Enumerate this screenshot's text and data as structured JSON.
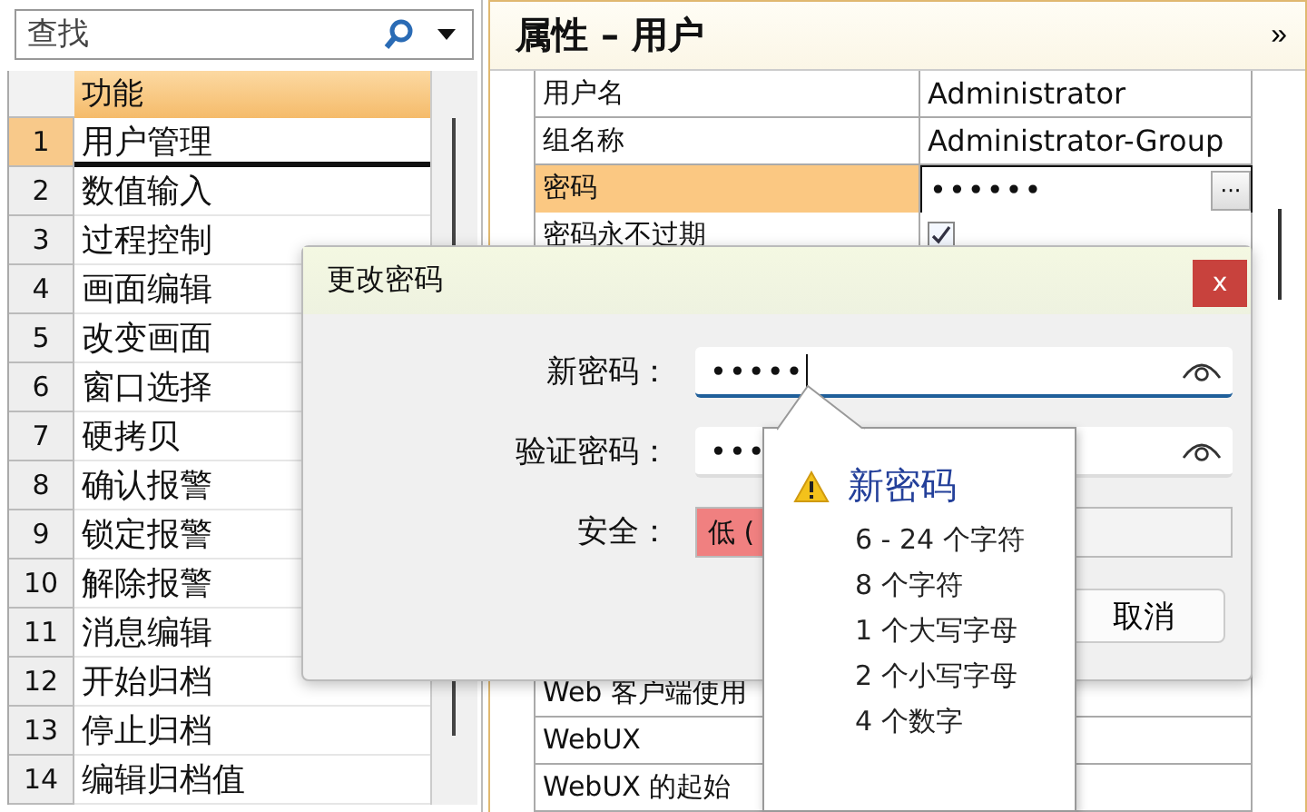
{
  "search": {
    "placeholder": "查找"
  },
  "function_list": {
    "column": "功能",
    "rows": [
      {
        "number": "1",
        "name": "用户管理",
        "selected": true
      },
      {
        "number": "2",
        "name": "数值输入",
        "selected": false
      },
      {
        "number": "3",
        "name": "过程控制",
        "selected": false
      },
      {
        "number": "4",
        "name": "画面编辑",
        "selected": false
      },
      {
        "number": "5",
        "name": "改变画面",
        "selected": false
      },
      {
        "number": "6",
        "name": "窗口选择",
        "selected": false
      },
      {
        "number": "7",
        "name": "硬拷贝",
        "selected": false
      },
      {
        "number": "8",
        "name": "确认报警",
        "selected": false
      },
      {
        "number": "9",
        "name": "锁定报警",
        "selected": false
      },
      {
        "number": "10",
        "name": "解除报警",
        "selected": false
      },
      {
        "number": "11",
        "name": "消息编辑",
        "selected": false
      },
      {
        "number": "12",
        "name": "开始归档",
        "selected": false
      },
      {
        "number": "13",
        "name": "停止归档",
        "selected": false
      },
      {
        "number": "14",
        "name": "编辑归档值",
        "selected": false
      }
    ]
  },
  "properties": {
    "title": "属性 – 用户",
    "expand": "»",
    "rows": [
      {
        "kind": "text",
        "name": "用户名",
        "value": "Administrator",
        "selected": false
      },
      {
        "kind": "text",
        "name": "组名称",
        "value": "Administrator-Group",
        "selected": false
      },
      {
        "kind": "password",
        "name": "密码",
        "value": "••••••",
        "button": "···",
        "selected": true
      },
      {
        "kind": "checkbox",
        "name": "密码永不过期",
        "checked": true,
        "selected": false
      }
    ],
    "more_rows": [
      {
        "kind": "text",
        "name": "Web 客户端使用",
        "selected": false
      },
      {
        "kind": "text",
        "name": "WebUX",
        "selected": false
      },
      {
        "kind": "text",
        "name": "WebUX 的起始",
        "selected": false
      }
    ]
  },
  "dialog": {
    "title": "更改密码",
    "close": "x",
    "fields": [
      {
        "label": "新密码：",
        "value": "•••••",
        "focused": true
      },
      {
        "label": "验证密码：",
        "value": "•••",
        "focused": false
      }
    ],
    "security": {
      "label": "安全：",
      "reading": "低 (",
      "level": 0.35
    },
    "buttons": [
      "取消"
    ]
  },
  "tooltip": {
    "title": "新密码",
    "lines": [
      "6 - 24 个字符",
      "8 个字符",
      "1 个大写字母",
      "2 个小写字母",
      "4 个数字"
    ]
  }
}
